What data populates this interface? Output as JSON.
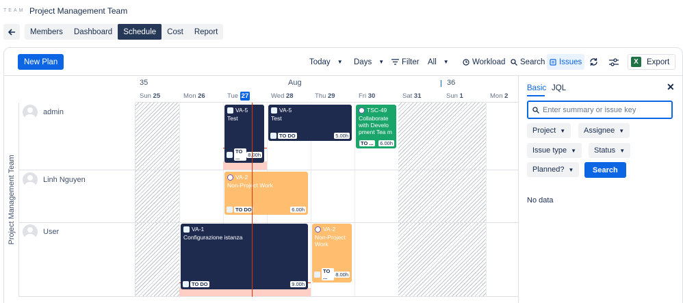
{
  "header": {
    "logo_text": "TEAM",
    "title": "Project Management Team"
  },
  "tabs": [
    {
      "label": "Members",
      "active": false
    },
    {
      "label": "Dashboard",
      "active": false
    },
    {
      "label": "Schedule",
      "active": true
    },
    {
      "label": "Cost",
      "active": false
    },
    {
      "label": "Report",
      "active": false
    }
  ],
  "toolbar": {
    "new_plan": "New Plan",
    "today": "Today",
    "view": "Days",
    "filter": "Filter",
    "filter_value": "All",
    "workload": "Workload",
    "search": "Search",
    "issues": "Issues",
    "export": "Export",
    "export_icon_letter": "X"
  },
  "timeline": {
    "weeks": [
      "35",
      "36"
    ],
    "month": "Aug",
    "days": [
      {
        "dow": "Sun",
        "num": "25"
      },
      {
        "dow": "Mon",
        "num": "26"
      },
      {
        "dow": "Tue",
        "num": "27",
        "today": true
      },
      {
        "dow": "Wed",
        "num": "28"
      },
      {
        "dow": "Thu",
        "num": "29"
      },
      {
        "dow": "Fri",
        "num": "30"
      },
      {
        "dow": "Sat",
        "num": "31"
      },
      {
        "dow": "Sun",
        "num": "1"
      },
      {
        "dow": "Mon",
        "num": "2"
      }
    ]
  },
  "team_label": "Project Management Team",
  "members": [
    {
      "name": "admin"
    },
    {
      "name": "Linh Nguyen"
    },
    {
      "name": "User"
    }
  ],
  "issues": [
    {
      "key": "VA-5",
      "summary": "Test",
      "status": "TO ...",
      "hours": "8.00h",
      "color": "navy"
    },
    {
      "key": "VA-5",
      "summary": "Test",
      "status": "TO DO",
      "hours": "5.00h",
      "color": "navy"
    },
    {
      "key": "TSC-49",
      "summary": "Collaborate with Develo pment Tea m",
      "status": "TO ...",
      "hours": "6.00h",
      "color": "green"
    },
    {
      "key": "VA-2",
      "summary": "Non-Project Work",
      "status": "TO DO",
      "hours": "6.00h",
      "color": "orange"
    },
    {
      "key": "VA-1",
      "summary": "Configurazione istanza",
      "status": "TO DO",
      "hours": "9.00h",
      "color": "navy"
    },
    {
      "key": "VA-2",
      "summary": "Non-Project Work",
      "status": "TO ...",
      "hours": "8.00h",
      "color": "orange"
    }
  ],
  "panel": {
    "tab_basic": "Basic",
    "tab_jql": "JQL",
    "search_placeholder": "Enter summary or issue key",
    "filters": {
      "project": "Project",
      "assignee": "Assignee",
      "issue_type": "Issue type",
      "status": "Status",
      "planned": "Planned?"
    },
    "search_button": "Search",
    "empty_text": "No data"
  }
}
